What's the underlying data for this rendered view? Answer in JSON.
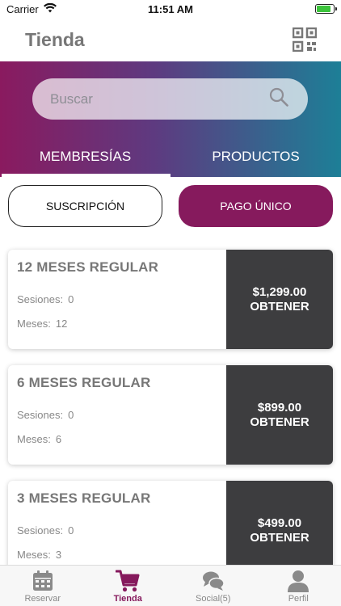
{
  "status_bar": {
    "carrier": "Carrier",
    "time": "11:51 AM",
    "battery_level": 0.85
  },
  "header": {
    "title": "Tienda"
  },
  "search": {
    "placeholder": "Buscar"
  },
  "tabs": [
    {
      "label": "MEMBRESÍAS",
      "active": true
    },
    {
      "label": "PRODUCTOS",
      "active": false
    }
  ],
  "segments": [
    {
      "label": "SUSCRIPCIÓN",
      "selected": false
    },
    {
      "label": "PAGO ÚNICO",
      "selected": true
    }
  ],
  "cards": [
    {
      "title": "12 MESES REGULAR",
      "sesiones_label": "Sesiones:",
      "sesiones": "0",
      "meses_label": "Meses:",
      "meses": "12",
      "price": "$1,299.00",
      "action": "OBTENER"
    },
    {
      "title": "6 MESES REGULAR",
      "sesiones_label": "Sesiones:",
      "sesiones": "0",
      "meses_label": "Meses:",
      "meses": "6",
      "price": "$899.00",
      "action": "OBTENER"
    },
    {
      "title": "3 MESES REGULAR",
      "sesiones_label": "Sesiones:",
      "sesiones": "0",
      "meses_label": "Meses:",
      "meses": "3",
      "price": "$499.00",
      "action": "OBTENER"
    }
  ],
  "tabbar": [
    {
      "label": "Reservar",
      "icon": "calendar-icon",
      "active": false
    },
    {
      "label": "Tienda",
      "icon": "cart-icon",
      "active": true
    },
    {
      "label": "Social(5)",
      "icon": "chat-icon",
      "active": false
    },
    {
      "label": "Perfil",
      "icon": "person-icon",
      "active": false
    }
  ],
  "colors": {
    "accent": "#861a5d",
    "gradient_start": "#8a1a5f",
    "gradient_end": "#1d7f97",
    "card_action_bg": "#3d3d3f"
  }
}
